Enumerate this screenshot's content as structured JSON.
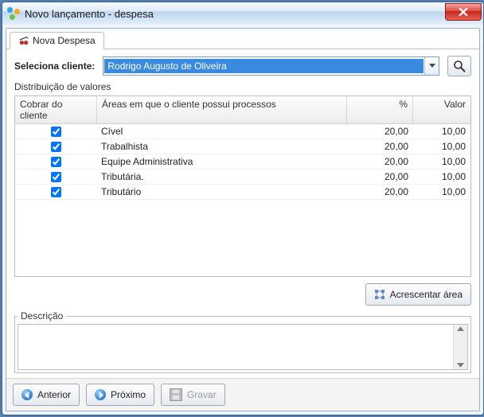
{
  "window": {
    "title": "Novo lançamento - despesa"
  },
  "tab": {
    "label": "Nova Despesa"
  },
  "client": {
    "label": "Seleciona cliente:",
    "selected": "Rodrigo Augusto de Oliveira"
  },
  "distribution": {
    "title": "Distribuição de valores",
    "headers": {
      "charge": "Cobrar do cliente",
      "area": "Áreas em que o cliente possui processos",
      "pct": "%",
      "value": "Valor"
    },
    "rows": [
      {
        "checked": true,
        "area": "Cível",
        "pct": "20,00",
        "value": "10,00"
      },
      {
        "checked": true,
        "area": "Trabalhista",
        "pct": "20,00",
        "value": "10,00"
      },
      {
        "checked": true,
        "area": "Equipe Administrativa",
        "pct": "20,00",
        "value": "10,00"
      },
      {
        "checked": true,
        "area": "Tributária.",
        "pct": "20,00",
        "value": "10,00"
      },
      {
        "checked": true,
        "area": "Tributário",
        "pct": "20,00",
        "value": "10,00"
      }
    ],
    "add_button": "Acrescentar área"
  },
  "description": {
    "legend": "Descrição",
    "value": ""
  },
  "footer": {
    "prev": "Anterior",
    "next": "Próximo",
    "save": "Gravar"
  },
  "icons": {
    "close": "close-icon",
    "search": "search-icon",
    "dropdown": "chevron-down-icon",
    "add": "add-area-icon",
    "prev": "arrow-left-icon",
    "next": "arrow-right-icon",
    "save": "save-icon",
    "tab": "expense-icon"
  }
}
